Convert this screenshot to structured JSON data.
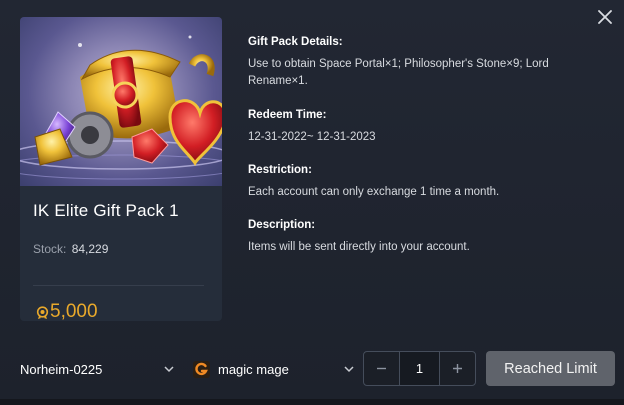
{
  "gift": {
    "name": "IK Elite Gift Pack 1",
    "stock_label": "Stock:",
    "stock_value": "84,229",
    "price": "5,000"
  },
  "details": {
    "pack_title": "Gift Pack Details:",
    "pack_text": "Use to obtain Space Portal×1; Philosopher's Stone×9; Lord Rename×1.",
    "redeem_title": "Redeem Time:",
    "redeem_text": "12-31-2022~ 12-31-2023",
    "restriction_title": "Restriction:",
    "restriction_text": "Each account can only exchange 1 time a month.",
    "description_title": "Description:",
    "description_text": "Items will be sent directly into your account."
  },
  "footer": {
    "server": "Norheim-0225",
    "character": "magic mage",
    "quantity": "1",
    "action_label": "Reached Limit"
  },
  "icons": {
    "close": "close-icon",
    "chevron": "chevron-down-icon",
    "coin": "coin-icon",
    "game_logo": "g-logo-icon",
    "minus": "minus-icon",
    "plus": "plus-icon"
  },
  "colors": {
    "price": "#e9a92b",
    "button_disabled": "#5f636b",
    "game_logo": "#f08a24"
  }
}
